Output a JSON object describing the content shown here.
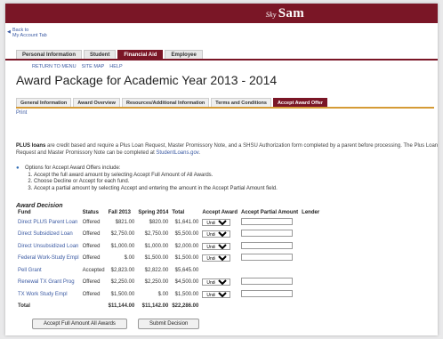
{
  "header": {
    "brand_prefix": "Sky",
    "brand": "Sam"
  },
  "back": {
    "line1": "Back to",
    "line2": "My Account Tab"
  },
  "tabs": [
    {
      "label": "Personal Information",
      "active": false
    },
    {
      "label": "Student",
      "active": false
    },
    {
      "label": "Financial Aid",
      "active": true
    },
    {
      "label": "Employee",
      "active": false
    }
  ],
  "links": [
    "RETURN TO MENU",
    "SITE MAP",
    "HELP"
  ],
  "title": "Award Package for Academic Year 2013 - 2014",
  "subtabs": [
    {
      "label": "General Information",
      "active": false
    },
    {
      "label": "Award Overview",
      "active": false
    },
    {
      "label": "Resources/Additional Information",
      "active": false
    },
    {
      "label": "Terms and Conditions",
      "active": false
    },
    {
      "label": "Accept Award Offer",
      "active": true
    }
  ],
  "print": "Print",
  "intro": {
    "bold": "PLUS loans",
    "text1": " are credit based and require a Plus Loan Request, Master Promissory Note, and a SHSU Authorization form completed by a parent before processing. The Plus Loan Request and Master Promissory Note can be completed at ",
    "link": "StudentLoans.gov",
    "text2": "."
  },
  "options": {
    "heading": "Options for Accept Award Offers include:",
    "items": [
      "Accept the full award amount by selecting Accept Full Amount of All Awards.",
      "Choose Decline or Accept for each fund.",
      "Accept a partial amount by selecting Accept and entering the amount in the Accept Partial Amount field."
    ]
  },
  "award": {
    "heading": "Award Decision",
    "columns": [
      "Fund",
      "Status",
      "Fall 2013",
      "Spring 2014",
      "Total",
      "Accept Award",
      "Accept Partial Amount",
      "Lender"
    ],
    "rows": [
      {
        "fund": "Direct PLUS Parent Loan",
        "status": "Offered",
        "fall": "$821.00",
        "spring": "$820.00",
        "total": "$1,641.00",
        "decision": "Undecided",
        "link": true
      },
      {
        "fund": "Direct Subsidized Loan",
        "status": "Offered",
        "fall": "$2,750.00",
        "spring": "$2,750.00",
        "total": "$5,500.00",
        "decision": "Undecided",
        "link": true
      },
      {
        "fund": "Direct Unsubsidized Loan",
        "status": "Offered",
        "fall": "$1,000.00",
        "spring": "$1,000.00",
        "total": "$2,000.00",
        "decision": "Undecided",
        "link": true
      },
      {
        "fund": "Federal Work-Study Empl",
        "status": "Offered",
        "fall": "$.00",
        "spring": "$1,500.00",
        "total": "$1,500.00",
        "decision": "Undecided",
        "link": true
      },
      {
        "fund": "Pell Grant",
        "status": "Accepted",
        "fall": "$2,823.00",
        "spring": "$2,822.00",
        "total": "$5,645.00",
        "decision": "",
        "link": true
      },
      {
        "fund": "Renewal TX Grant Prog",
        "status": "Offered",
        "fall": "$2,250.00",
        "spring": "$2,250.00",
        "total": "$4,500.00",
        "decision": "Undecided",
        "link": true
      },
      {
        "fund": "TX Work Study Empl",
        "status": "Offered",
        "fall": "$1,500.00",
        "spring": "$.00",
        "total": "$1,500.00",
        "decision": "Undecided",
        "link": true
      }
    ],
    "total": {
      "label": "Total",
      "fall": "$11,144.00",
      "spring": "$11,142.00",
      "total": "$22,286.00"
    }
  },
  "buttons": {
    "accept_all": "Accept Full Amount All Awards",
    "submit": "Submit Decision"
  },
  "colors": {
    "brand": "#7a1626",
    "link": "#3b5aa3",
    "accent": "#d59b36"
  }
}
